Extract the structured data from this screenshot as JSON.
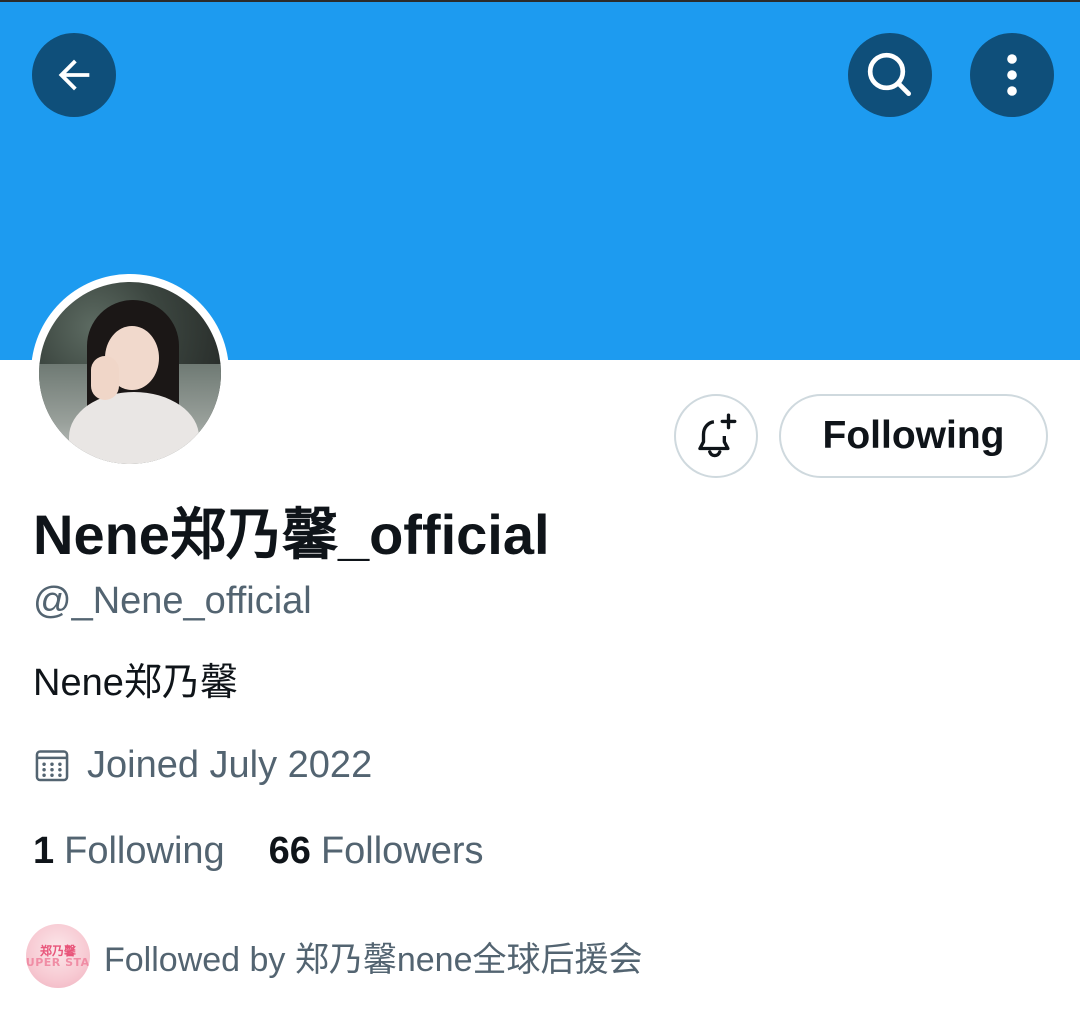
{
  "colors": {
    "banner": "#1d9bf0",
    "header_button_bg": "#0f4f7a",
    "text_primary": "#0f1419",
    "text_secondary": "#536471",
    "border": "#cfd9de"
  },
  "header": {
    "back_icon": "arrow-left-icon",
    "search_icon": "search-icon",
    "more_icon": "more-vertical-icon"
  },
  "profile": {
    "display_name": "Nene郑乃馨_official",
    "handle": "@_Nene_official",
    "bio": "Nene郑乃馨",
    "joined": "Joined July 2022",
    "notify_icon": "bell-plus-icon",
    "follow_button_label": "Following"
  },
  "stats": {
    "following_count": "1",
    "following_label": "Following",
    "followers_count": "66",
    "followers_label": "Followers"
  },
  "followed_by": {
    "text": "Followed by 郑乃馨nene全球后援会",
    "avatar_logo_text_1": "郑乃馨",
    "avatar_logo_text_2": "SUPER STAR"
  }
}
